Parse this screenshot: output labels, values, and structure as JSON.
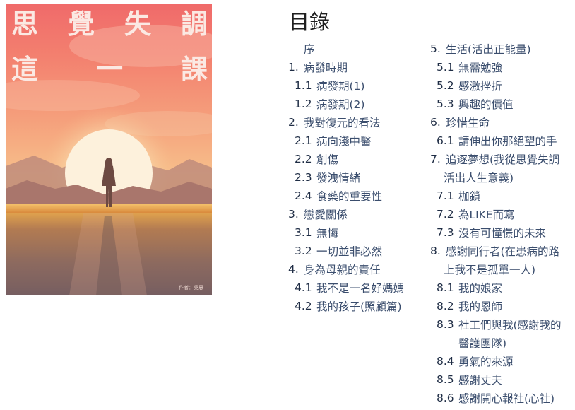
{
  "cover": {
    "title_row1": [
      "思",
      "覺",
      "失",
      "調"
    ],
    "title_row2": [
      "這",
      "一",
      "課"
    ],
    "author": "作者：吳恩",
    "colors": {
      "sky_top": "#f06a6a",
      "sun": "#fdf1dc",
      "ground": "#7a6160"
    }
  },
  "toc": {
    "title": "目錄",
    "left_column": [
      {
        "num": "",
        "text": "序"
      },
      {
        "num": "1.",
        "text": "病發時期"
      },
      {
        "num": "1.1",
        "text": "病發期(1)"
      },
      {
        "num": "1.2",
        "text": "病發期(2)"
      },
      {
        "num": "2.",
        "text": "我對復元的看法"
      },
      {
        "num": "2.1",
        "text": "病向淺中醫"
      },
      {
        "num": "2.2",
        "text": "創傷"
      },
      {
        "num": "2.3",
        "text": "發洩情緒"
      },
      {
        "num": "2.4",
        "text": "食藥的重要性"
      },
      {
        "num": "3.",
        "text": "戀愛關係"
      },
      {
        "num": "3.1",
        "text": "無悔"
      },
      {
        "num": "3.2",
        "text": "一切並非必然"
      },
      {
        "num": "4.",
        "text": "身為母親的責任"
      },
      {
        "num": "4.1",
        "text": "我不是一名好媽媽"
      },
      {
        "num": "4.2",
        "text": "我的孩子(照顧篇)"
      }
    ],
    "right_column": [
      {
        "num": "5.",
        "text": "生活(活出正能量)"
      },
      {
        "num": "5.1",
        "text": "無需勉強"
      },
      {
        "num": "5.2",
        "text": "感激挫折"
      },
      {
        "num": "5.3",
        "text": "興趣的價值"
      },
      {
        "num": "6.",
        "text": "珍惜生命"
      },
      {
        "num": "6.1",
        "text": "請伸出你那絕望的手"
      },
      {
        "num": "7.",
        "text": "追逐夢想(我從思覺失調"
      },
      {
        "num": "",
        "text": "活出人生意義)"
      },
      {
        "num": "7.1",
        "text": "枷鎖"
      },
      {
        "num": "7.2",
        "text": "為LIKE而寫"
      },
      {
        "num": "7.3",
        "text": "沒有可憧憬的未來"
      },
      {
        "num": "8.",
        "text": "感謝同行者(在患病的路"
      },
      {
        "num": "",
        "text": "上我不是孤單一人)"
      },
      {
        "num": "8.1",
        "text": "我的娘家"
      },
      {
        "num": "8.2",
        "text": "我的恩師"
      },
      {
        "num": "8.3",
        "text": "社工們與我(感謝我的"
      },
      {
        "num": "",
        "text": "醫護團隊)"
      },
      {
        "num": "8.4",
        "text": "勇氣的來源"
      },
      {
        "num": "8.5",
        "text": "感謝丈夫"
      },
      {
        "num": "8.6",
        "text": "感謝開心報社(心社)"
      }
    ]
  }
}
